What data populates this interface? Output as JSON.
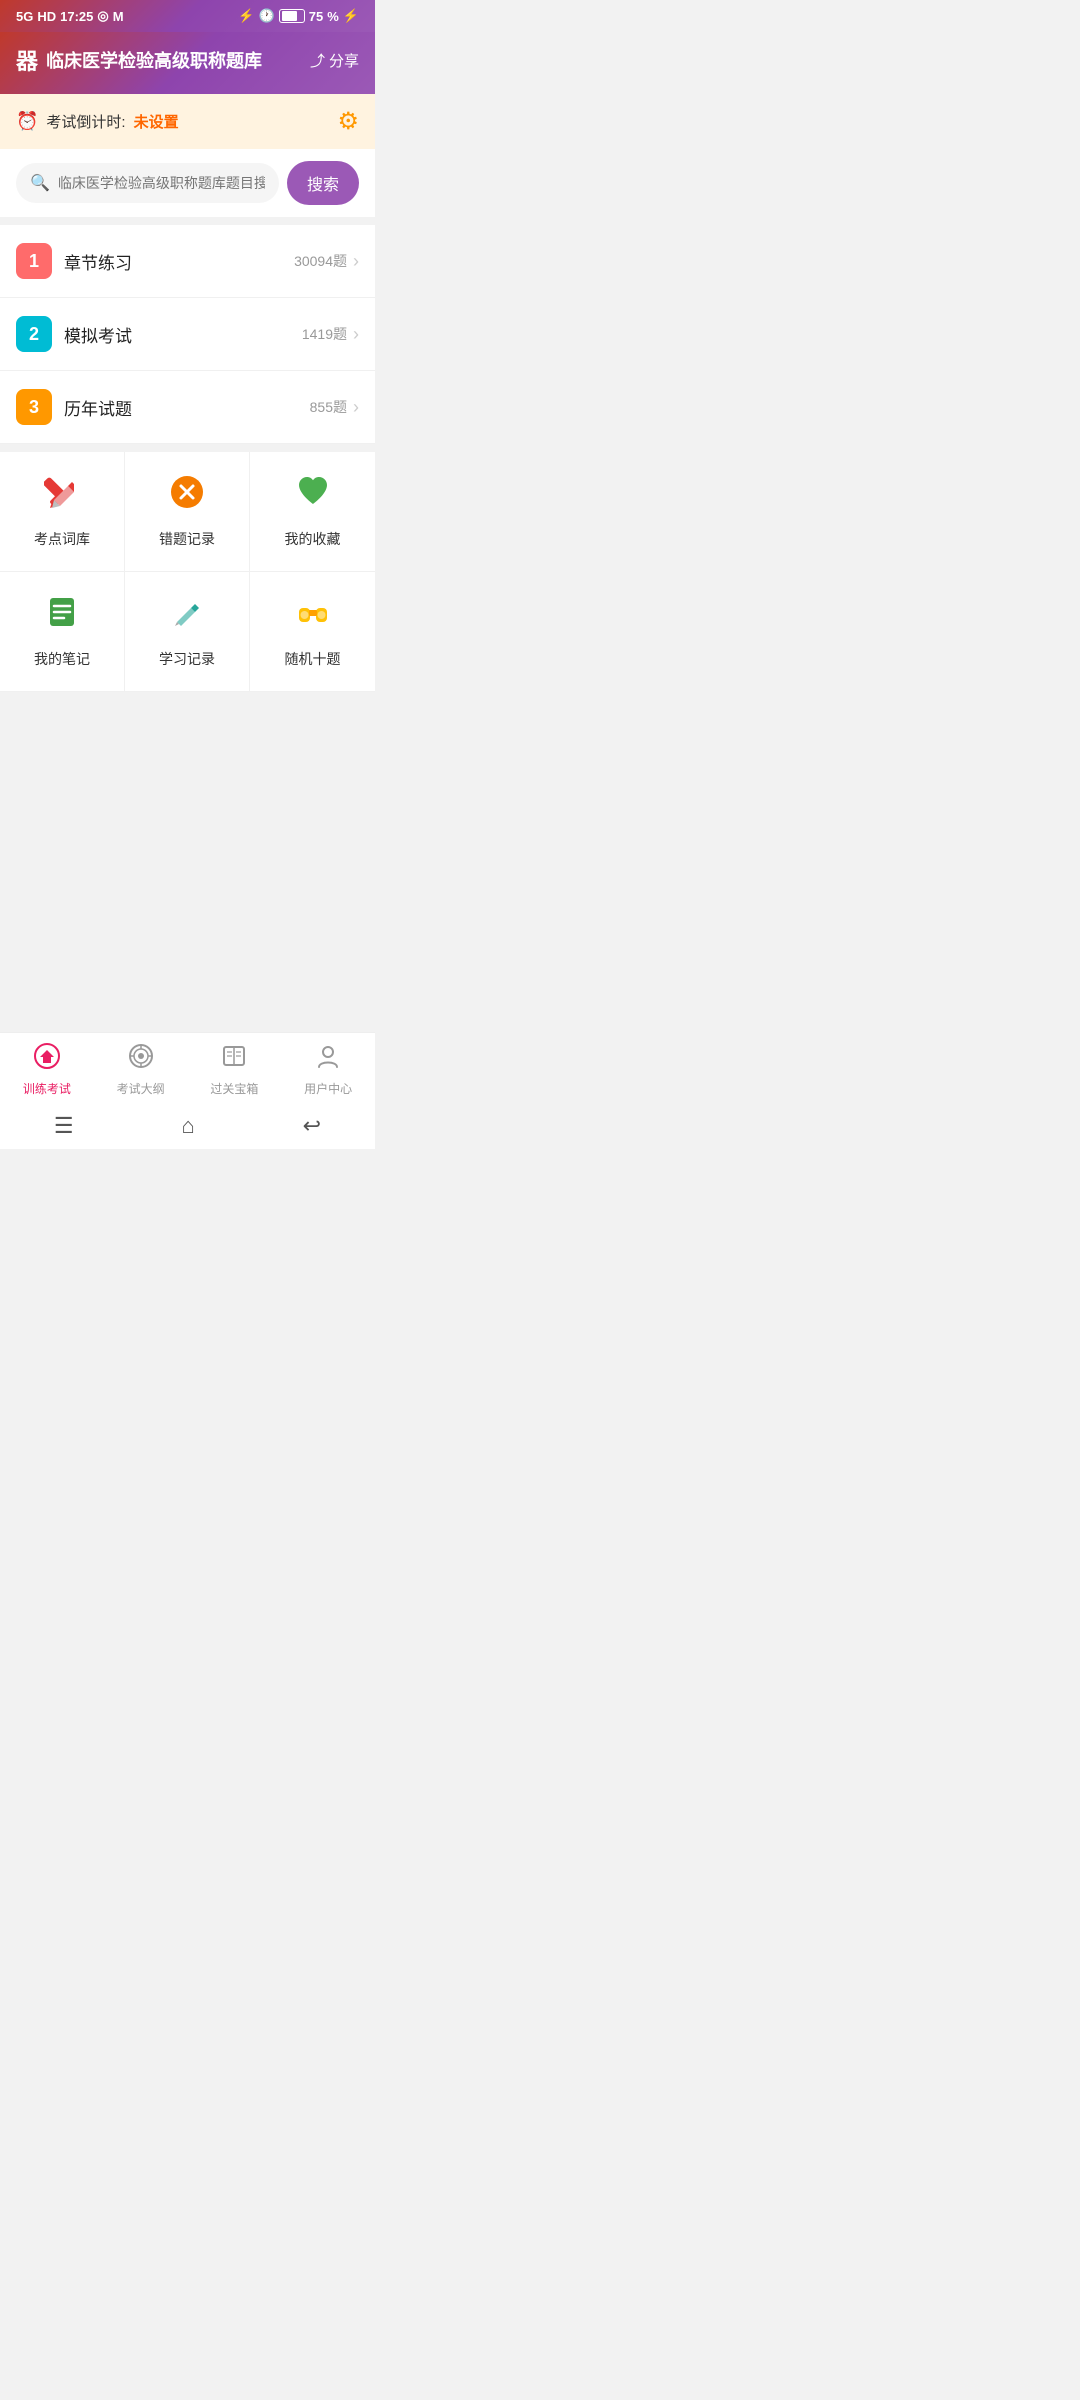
{
  "statusBar": {
    "time": "17:25",
    "signal": "5G",
    "hd": "HD",
    "batteryPercent": 75
  },
  "header": {
    "iconLabel": "器",
    "title": "临床医学检验高级职称题库",
    "shareLabel": "分享"
  },
  "countdown": {
    "label": "考试倒计时:",
    "value": "未设置"
  },
  "search": {
    "placeholder": "临床医学检验高级职称题库题目搜索",
    "buttonLabel": "搜索"
  },
  "categories": [
    {
      "num": "1",
      "name": "章节练习",
      "count": "30094题",
      "colorClass": "num-red"
    },
    {
      "num": "2",
      "name": "模拟考试",
      "count": "1419题",
      "colorClass": "num-cyan"
    },
    {
      "num": "3",
      "name": "历年试题",
      "count": "855题",
      "colorClass": "num-orange"
    }
  ],
  "gridRow1": [
    {
      "icon": "✏️",
      "label": "考点词库",
      "iconClass": "icon-pencil"
    },
    {
      "icon": "❌",
      "label": "错题记录",
      "iconClass": "icon-x-circle"
    },
    {
      "icon": "💚",
      "label": "我的收藏",
      "iconClass": "icon-heart"
    }
  ],
  "gridRow2": [
    {
      "icon": "📋",
      "label": "我的笔记",
      "iconClass": "icon-notes"
    },
    {
      "icon": "✒️",
      "label": "学习记录",
      "iconClass": "icon-pen"
    },
    {
      "icon": "🔭",
      "label": "随机十题",
      "iconClass": "icon-binoculars"
    }
  ],
  "bottomNav": [
    {
      "icon": "⊙",
      "label": "训练考试",
      "active": true,
      "iconUnicode": "🏠"
    },
    {
      "icon": "◎",
      "label": "考试大纲",
      "active": false,
      "iconUnicode": "🎯"
    },
    {
      "icon": "📖",
      "label": "过关宝箱",
      "active": false,
      "iconUnicode": "📖"
    },
    {
      "icon": "👤",
      "label": "用户中心",
      "active": false,
      "iconUnicode": "👤"
    }
  ],
  "androidNav": {
    "menuIcon": "☰",
    "homeIcon": "⌂",
    "backIcon": "↩"
  }
}
